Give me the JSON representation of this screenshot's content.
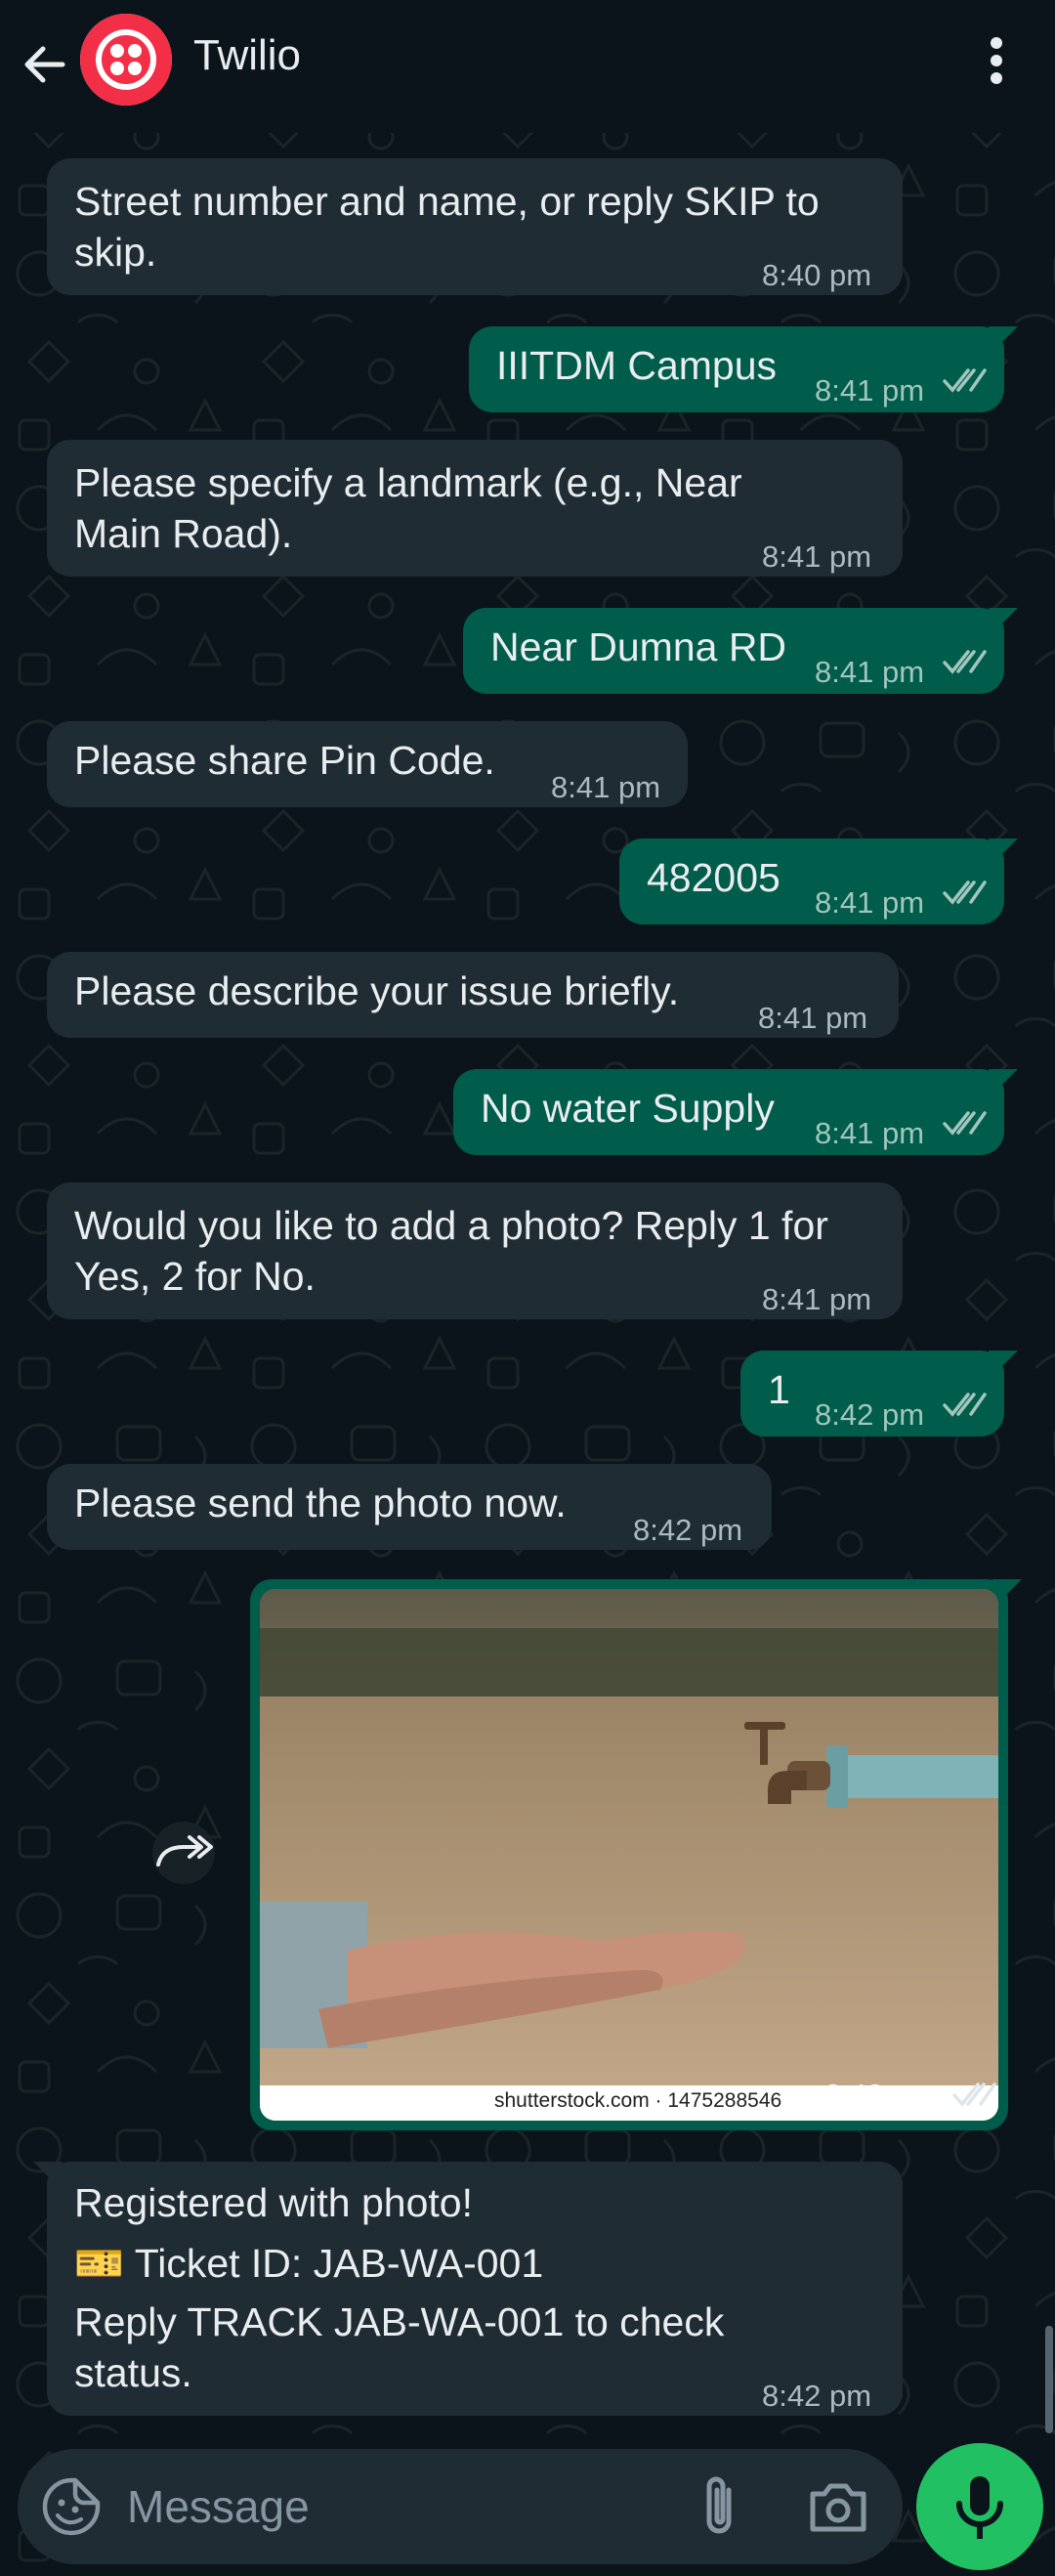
{
  "header": {
    "title": "Twilio",
    "icons": {
      "back": "arrow-left-icon",
      "avatar": "twilio-logo",
      "menu": "more-vert-icon"
    }
  },
  "messages": [
    {
      "dir": "in",
      "lines": [
        "Street number and name, or reply SKIP to",
        "skip."
      ],
      "time": "8:40 pm"
    },
    {
      "dir": "out",
      "lines": [
        "IIITDM Campus"
      ],
      "time": "8:41 pm",
      "read": true
    },
    {
      "dir": "in",
      "lines": [
        "Please specify a landmark (e.g., Near",
        "Main Road)."
      ],
      "time": "8:41 pm"
    },
    {
      "dir": "out",
      "lines": [
        "Near Dumna RD"
      ],
      "time": "8:41 pm",
      "read": true
    },
    {
      "dir": "in",
      "lines": [
        "Please share Pin Code."
      ],
      "time": "8:41 pm"
    },
    {
      "dir": "out",
      "lines": [
        "482005"
      ],
      "time": "8:41 pm",
      "read": true
    },
    {
      "dir": "in",
      "lines": [
        "Please describe your issue briefly."
      ],
      "time": "8:41 pm"
    },
    {
      "dir": "out",
      "lines": [
        "No water Supply"
      ],
      "time": "8:41 pm",
      "read": true
    },
    {
      "dir": "in",
      "lines": [
        "Would you like to add a photo? Reply 1 for",
        "Yes, 2 for No."
      ],
      "time": "8:41 pm"
    },
    {
      "dir": "out",
      "lines": [
        "1"
      ],
      "time": "8:42 pm",
      "read": true
    },
    {
      "dir": "in",
      "lines": [
        "Please send the photo now."
      ],
      "time": "8:42 pm"
    },
    {
      "dir": "in",
      "lines": [
        "Registered with photo!",
        "🎫 Ticket ID: JAB-WA-001",
        "Reply TRACK JAB-WA-001 to check",
        "status."
      ],
      "time": "8:42 pm"
    }
  ],
  "photo": {
    "watermark": "shutterstock.com · 1475288546",
    "time": "8:42 pm",
    "read": true,
    "forward_icon": "forward-icon"
  },
  "composer": {
    "placeholder": "Message",
    "icons": {
      "emoji": "sticker-icon",
      "attach": "paperclip-icon",
      "camera": "camera-icon",
      "mic": "mic-icon"
    }
  },
  "colors": {
    "background": "#0b141a",
    "incoming": "#202c33",
    "outgoing": "#005c4b",
    "accent": "#21c063",
    "brand": "#f22f46"
  }
}
